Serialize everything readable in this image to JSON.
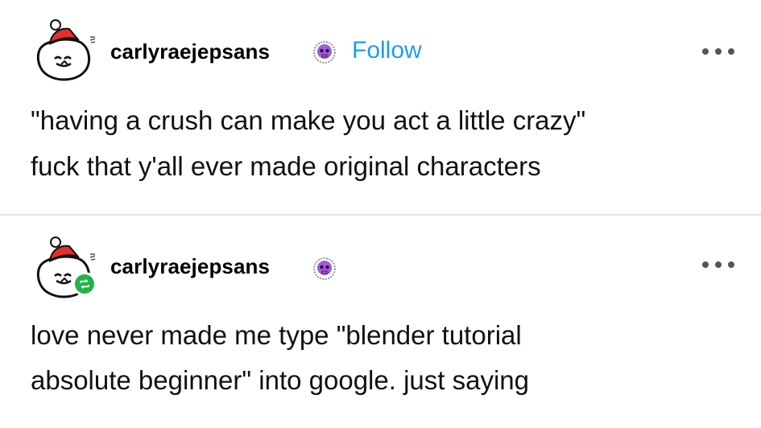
{
  "posts": [
    {
      "username": "carlyraejepsans",
      "follow_label": "Follow",
      "lines": [
        "\"having a crush can make you act a little crazy\"",
        "fuck that y'all ever made original characters"
      ],
      "avatar_icon": "snowman-santa-hat-avatar-icon",
      "badge_icon": "purple-skull-badge-icon"
    },
    {
      "username": "carlyraejepsans",
      "lines": [
        "love never made me type \"blender tutorial",
        "absolute beginner\" into google. just saying"
      ],
      "avatar_icon": "snowman-santa-hat-avatar-icon",
      "badge_icon": "purple-skull-badge-icon",
      "reblog_icon": "reblog-icon"
    }
  ],
  "colors": {
    "follow": "#1e9ee6",
    "badge": "#a25bd6",
    "reblog": "#22b34a",
    "divider": "#e3e3e3"
  }
}
